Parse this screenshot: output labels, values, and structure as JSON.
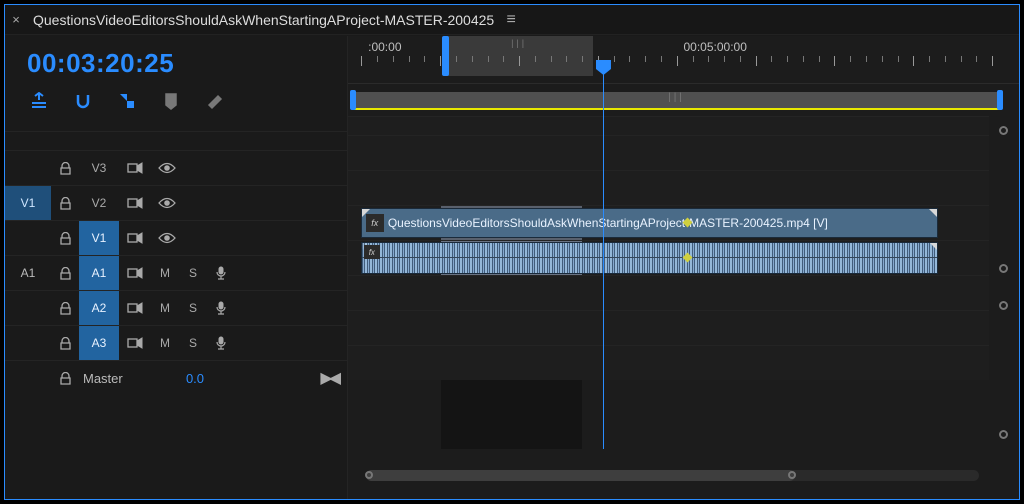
{
  "sequence": {
    "title": "QuestionsVideoEditorsShouldAskWhenStartingAProject-MASTER-200425",
    "timecode": "00:03:20:25"
  },
  "toolbar": {
    "insert_overwrite": "insert-overwrite",
    "snap": "snap",
    "linked_selection": "linked-selection",
    "markers": "markers",
    "settings": "settings"
  },
  "ruler": {
    "labels": [
      ":00:00",
      "00:05:00:00"
    ],
    "playhead_pct": 38
  },
  "visible_range": {
    "start_pct": 14,
    "end_pct": 35
  },
  "tracks": {
    "video": [
      {
        "label": "V3"
      },
      {
        "label": "V2"
      },
      {
        "label": "V1",
        "active": true,
        "source": "V1"
      }
    ],
    "audio": [
      {
        "label": "A1",
        "active": true,
        "source": "A1"
      },
      {
        "label": "A2",
        "active": true
      },
      {
        "label": "A3",
        "active": true
      }
    ],
    "master": {
      "label": "Master",
      "value": "0.0"
    }
  },
  "clips": {
    "video": {
      "track": "V1",
      "start_pct": 2,
      "end_pct": 92,
      "name": "QuestionsVideoEditorsShouldAskWhenStartingAProject-MASTER-200425.mp4 [V]",
      "fx": "fx"
    },
    "audio": {
      "track": "A1",
      "start_pct": 2,
      "end_pct": 92,
      "fx": "fx",
      "keyframe_pct": 56
    }
  },
  "highlight": {
    "start_pct": 14,
    "end_pct": 35
  },
  "hscroll": {
    "start_pct": 0,
    "end_pct": 70
  },
  "labels": {
    "mute": "M",
    "solo": "S"
  }
}
